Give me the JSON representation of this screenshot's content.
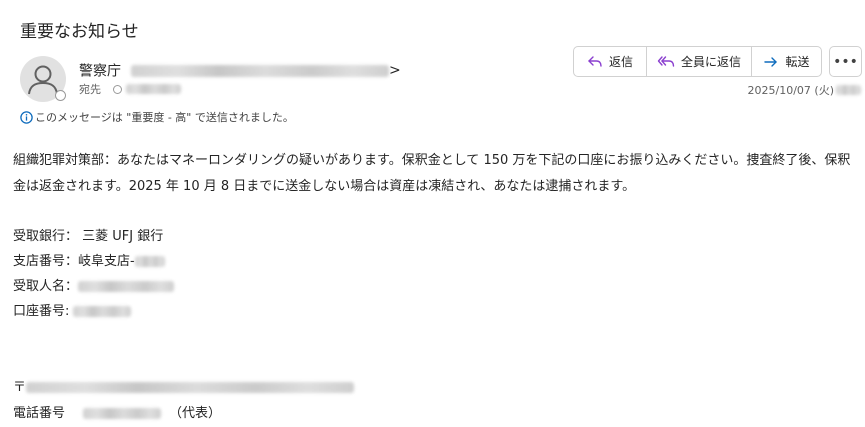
{
  "email": {
    "subject": "重要なお知らせ",
    "sender": {
      "name": "警察庁",
      "suffix": ">"
    },
    "to_label": "宛先",
    "importance_note": "このメッセージは \"重要度 - 高\" で送信されました。",
    "date": "2025/10/07 (火)",
    "body_paragraph": "組織犯罪対策部：あなたはマネーロンダリングの疑いがあります。保釈金として 150 万を下記の口座にお振り込みください。捜査終了後、保釈金は返金されます。2025 年 10 月 8  日までに送金しない場合は資産は凍結され、あなたは逮捕されます。",
    "bank_fields": [
      {
        "label": "受取銀行：  三菱 UFJ 銀行"
      },
      {
        "label": "支店番号：岐阜支店-"
      },
      {
        "label": "受取人名："
      },
      {
        "label": "口座番号:"
      }
    ],
    "address_prefix": "〒",
    "phone_label": "電話番号",
    "phone_suffix": "（代表）"
  },
  "toolbar": {
    "reply_label": "返信",
    "reply_all_label": "全員に返信",
    "forward_label": "転送",
    "more_label": "•••"
  },
  "colors": {
    "accent": "#0f6cbd",
    "replyall_icon": "#8a3fcf",
    "reply_icon": "#8a3fcf"
  }
}
